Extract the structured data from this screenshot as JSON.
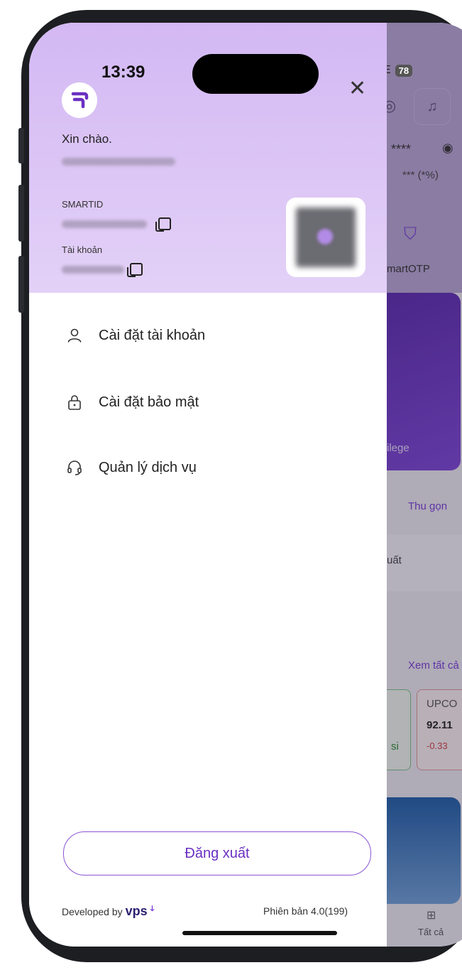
{
  "status_bar": {
    "time": "13:39",
    "network": "LTE",
    "battery": "78"
  },
  "drawer": {
    "greeting": "Xin chào.",
    "smartid_label": "SMARTID",
    "account_label": "Tài khoản",
    "menu": [
      {
        "label": "Cài đặt tài khoản",
        "icon": "user-icon"
      },
      {
        "label": "Cài đặt bảo mật",
        "icon": "lock-icon"
      },
      {
        "label": "Quản lý dịch vụ",
        "icon": "headset-icon"
      }
    ],
    "logout_label": "Đăng xuất",
    "footer": {
      "developed_by": "Developed by",
      "brand": "vps",
      "version": "Phiên bản 4.0(199)"
    }
  },
  "background_app": {
    "balance_masked": "**** ",
    "change_masked": "*** (*%)",
    "smartotp_label": "martOTP",
    "privilege_label": "ilege",
    "collapse_label": "Thu gọn",
    "export_label": "uất",
    "see_all_label": "Xem tất cả",
    "upcom_label": "UPCO",
    "upcom_value": "92.11",
    "upcom_change": "-0.33",
    "si_label": "si",
    "all_tab_label": "Tất cả"
  },
  "colors": {
    "accent": "#6a2fc2",
    "header_gradient_top": "#d3b8f3",
    "brand_dark": "#2b2171"
  }
}
